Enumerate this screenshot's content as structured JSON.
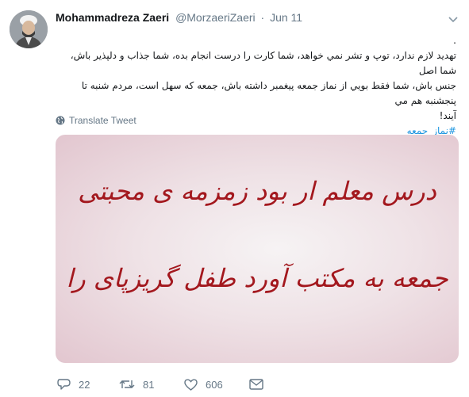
{
  "tweet": {
    "author_name": "Mohammadreza Zaeri",
    "handle": "@MorzaeriZaeri",
    "separator": "·",
    "date": "Jun 11",
    "dot_line": ".",
    "body_line1": "تهديد لازم ندارد، توپ و تشر نمي خواهد، شما كارت را درست انجام بده، شما جذاب و دلپذير باش، شما اصل",
    "body_line2": "جنس باش، شما فقط بويي از نماز جمعه پيغمبر داشته باش، جمعه كه سهل است، مردم شنبه تا پنجشنبه هم مي",
    "body_line3": "آيند!",
    "hashtag": "#نماز_جمعه",
    "translate_label": "Translate Tweet",
    "image_text_line1": "درس معلم ار بود زمزمه ی محبتی",
    "image_text_line2": "جمعه به مکتب آورد طفل گریزپای را"
  },
  "actions": {
    "reply_count": "22",
    "retweet_count": "81",
    "like_count": "606"
  },
  "colors": {
    "text": "#14171a",
    "secondary": "#657786",
    "link": "#1b95e0",
    "calligraphy": "#a3181e"
  },
  "icons": [
    "avatar",
    "chevron-down-icon",
    "globe-icon",
    "reply-icon",
    "retweet-icon",
    "like-icon",
    "direct-message-icon"
  ]
}
